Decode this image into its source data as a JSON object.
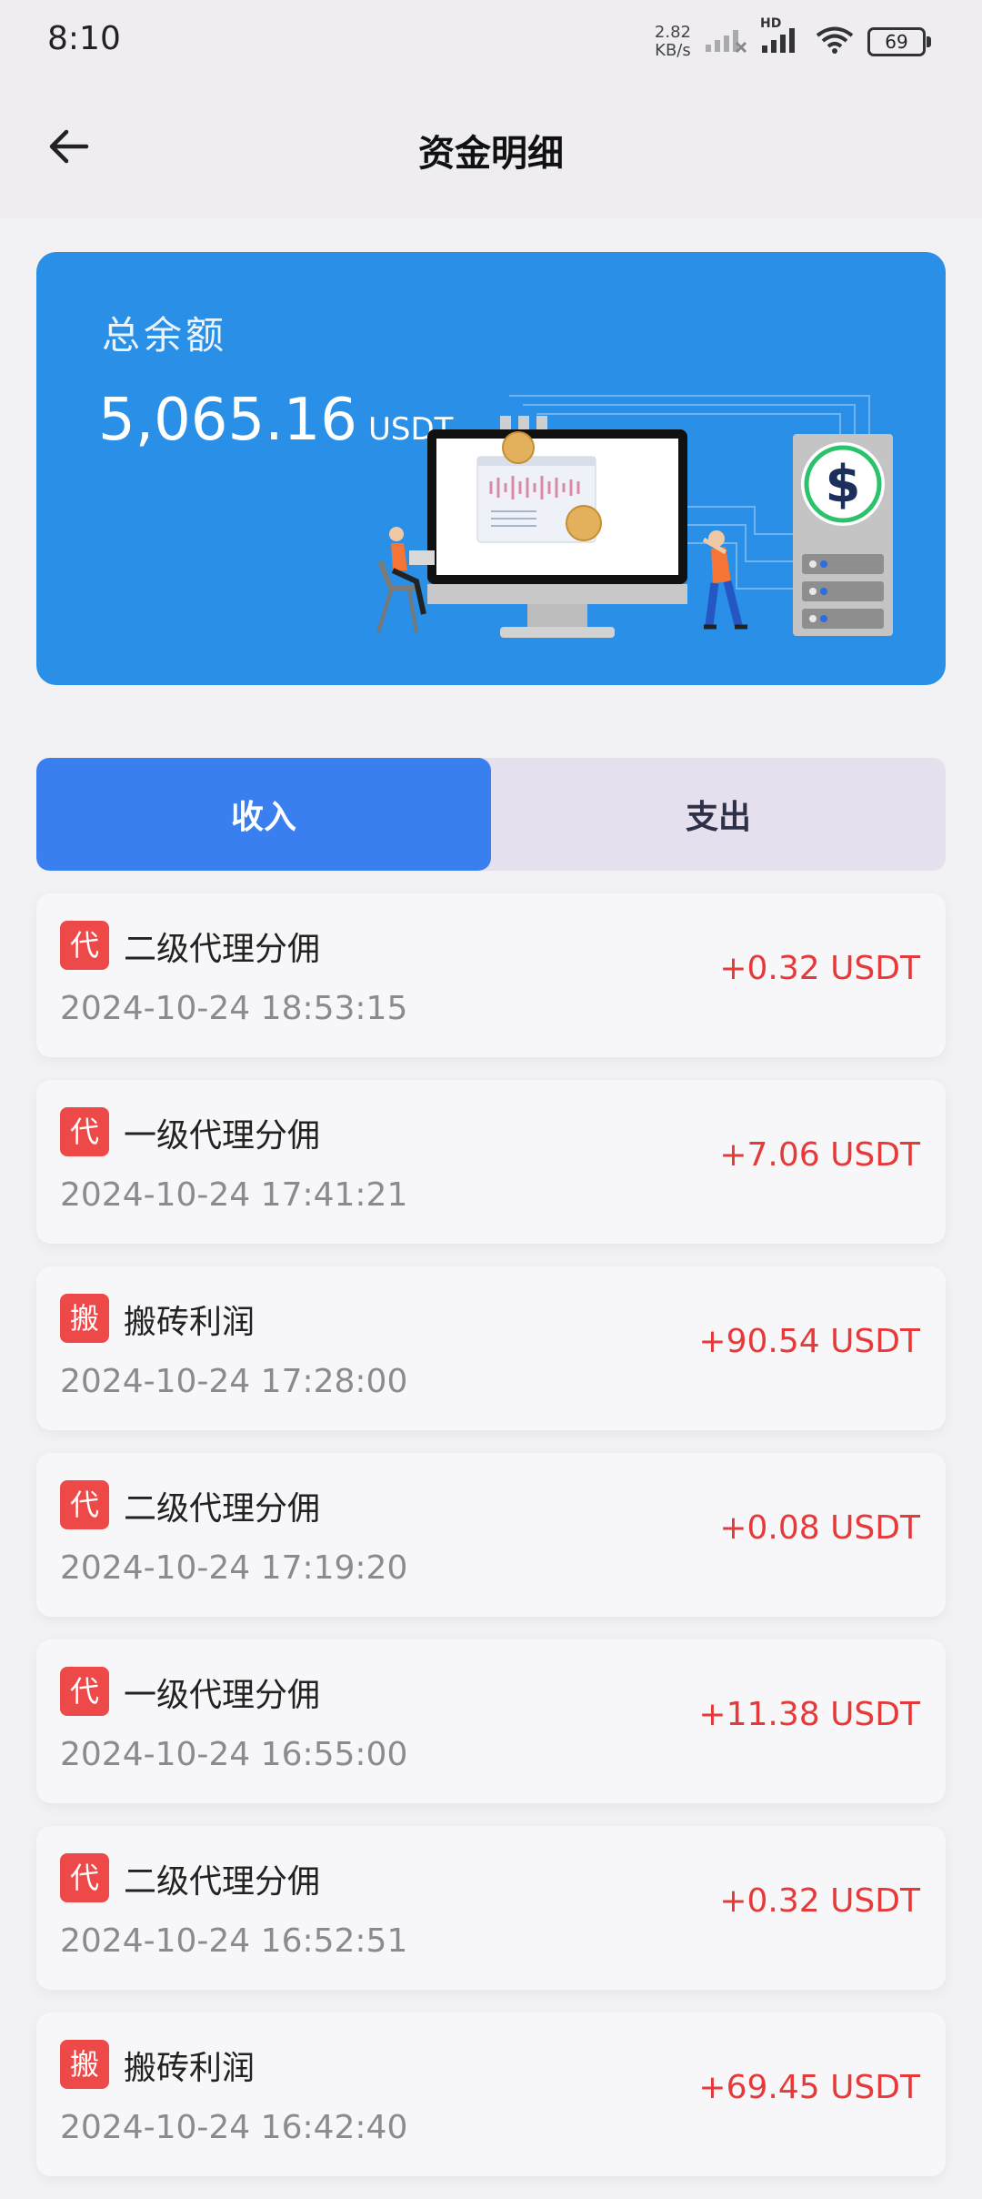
{
  "status_bar": {
    "time": "8:10",
    "net_speed_value": "2.82",
    "net_speed_unit": "KB/s",
    "hd_label": "HD",
    "battery": "69"
  },
  "header": {
    "title": "资金明细"
  },
  "balance": {
    "label": "总余额",
    "amount": "5,065.16",
    "unit": "USDT"
  },
  "tabs": [
    {
      "label": "收入",
      "active": true
    },
    {
      "label": "支出",
      "active": false
    }
  ],
  "records": [
    {
      "badge": "代",
      "title": "二级代理分佣",
      "time": "2024-10-24 18:53:15",
      "amount": "+0.32 USDT"
    },
    {
      "badge": "代",
      "title": "一级代理分佣",
      "time": "2024-10-24 17:41:21",
      "amount": "+7.06 USDT"
    },
    {
      "badge": "搬",
      "title": "搬砖利润",
      "time": "2024-10-24 17:28:00",
      "amount": "+90.54 USDT"
    },
    {
      "badge": "代",
      "title": "二级代理分佣",
      "time": "2024-10-24 17:19:20",
      "amount": "+0.08 USDT"
    },
    {
      "badge": "代",
      "title": "一级代理分佣",
      "time": "2024-10-24 16:55:00",
      "amount": "+11.38 USDT"
    },
    {
      "badge": "代",
      "title": "二级代理分佣",
      "time": "2024-10-24 16:52:51",
      "amount": "+0.32 USDT"
    },
    {
      "badge": "搬",
      "title": "搬砖利润",
      "time": "2024-10-24 16:42:40",
      "amount": "+69.45 USDT"
    }
  ],
  "colors": {
    "card_bg": "#2a8fe6",
    "tab_active": "#3a7ff0",
    "badge": "#ee4949",
    "amount": "#e63a3a"
  }
}
